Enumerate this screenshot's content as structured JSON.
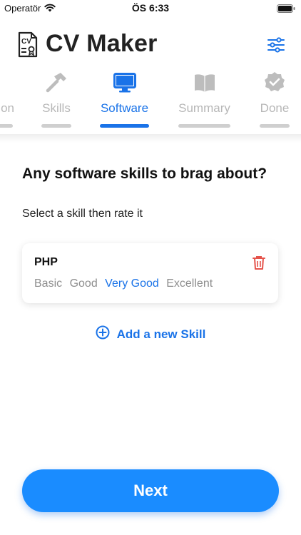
{
  "status_bar": {
    "carrier": "Operatör",
    "time": "ÖS 6:33"
  },
  "header": {
    "title": "CV Maker"
  },
  "steps": [
    {
      "label": "on",
      "icon": "person-icon",
      "active": false
    },
    {
      "label": "Skills",
      "icon": "hammer-icon",
      "active": false
    },
    {
      "label": "Software",
      "icon": "monitor-icon",
      "active": true
    },
    {
      "label": "Summary",
      "icon": "book-icon",
      "active": false
    },
    {
      "label": "Done",
      "icon": "check-badge-icon",
      "active": false
    }
  ],
  "main": {
    "question": "Any software skills to brag about?",
    "instruction": "Select a skill then rate it",
    "skills": [
      {
        "name": "PHP",
        "ratings": [
          "Basic",
          "Good",
          "Very Good",
          "Excellent"
        ],
        "selected": "Very Good"
      }
    ],
    "add_skill_label": "Add a new Skill"
  },
  "footer": {
    "next_label": "Next"
  },
  "colors": {
    "accent": "#1a73e8",
    "button": "#1a8cff",
    "delete": "#e5534b",
    "inactive": "#b7b7b7"
  }
}
